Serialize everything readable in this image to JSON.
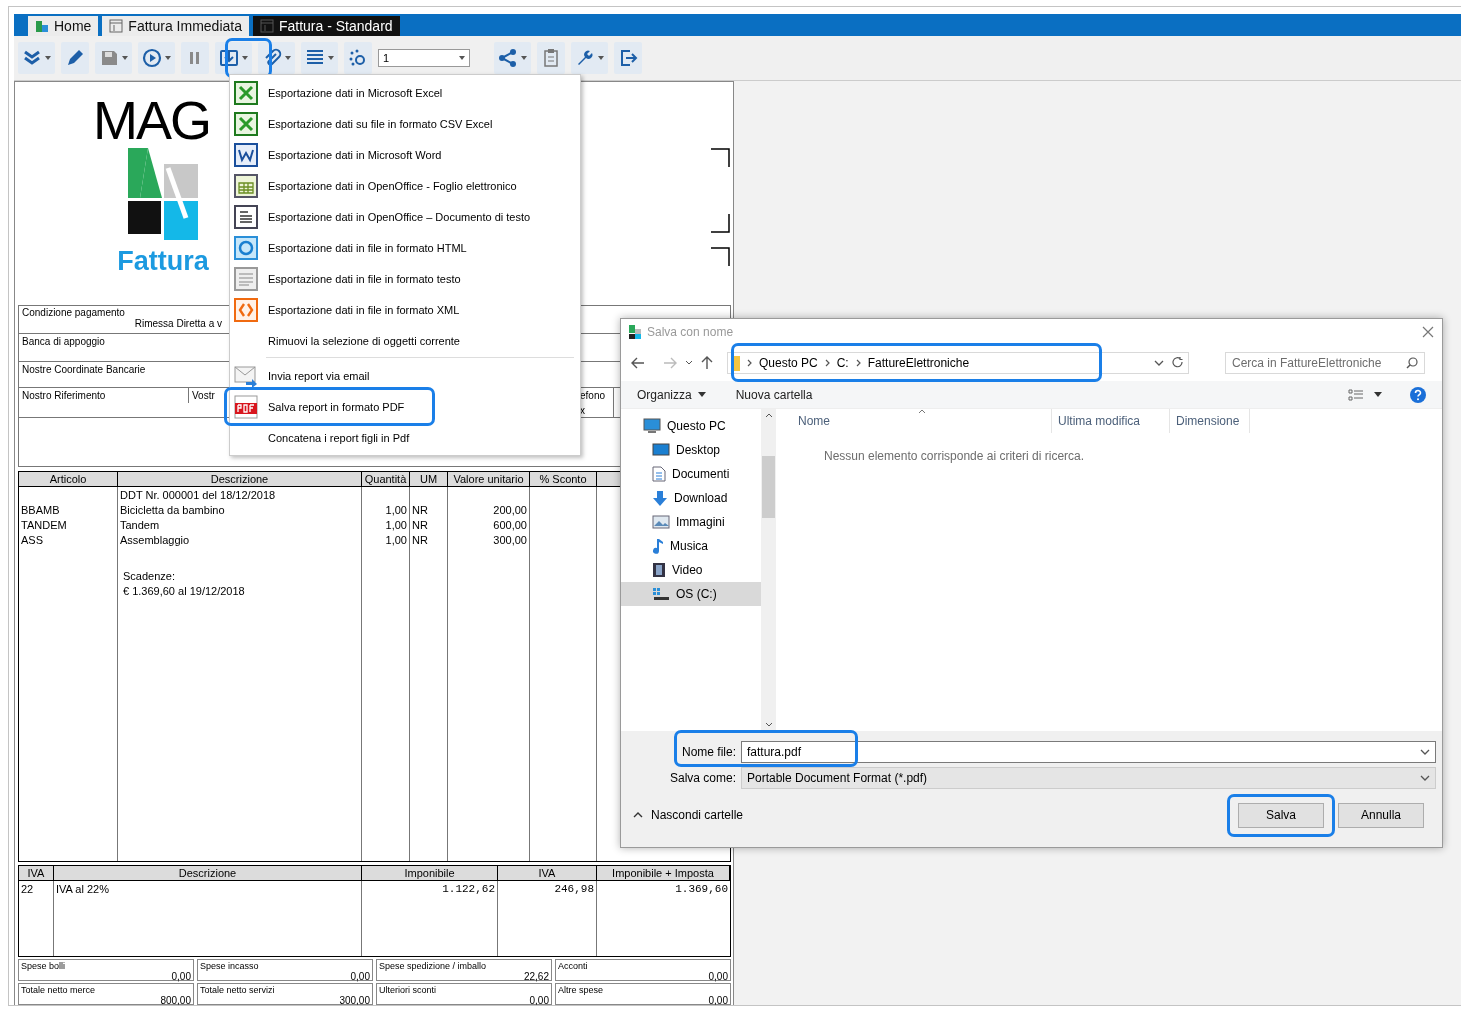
{
  "tabs": [
    {
      "label": "Home",
      "selected": false
    },
    {
      "label": "Fattura Immediata",
      "selected": false
    },
    {
      "label": "Fattura - Standard",
      "selected": true
    }
  ],
  "toolbar": {
    "export_highlighted": true,
    "page_field": {
      "value": "1"
    }
  },
  "report": {
    "logo_text": "MAG",
    "title": "Fattura",
    "info": {
      "payment_label": "Condizione pagamento",
      "payment_value": "Rimessa Diretta a v",
      "bank_label": "Banca di appoggio",
      "coordinates_label": "Nostre Coordinate Bancarie",
      "our_reference_label": "Nostro Riferimento",
      "your_reference_label": "Vostr",
      "phone_label": "efono",
      "fax_label": "x"
    },
    "items_table": {
      "columns": [
        "Articolo",
        "Descrizione",
        "Quantità",
        "UM",
        "Valore unitario",
        "% Sconto"
      ],
      "rows": [
        {
          "description": "DDT Nr. 000001 del 18/12/2018"
        },
        {
          "article": "BBAMB",
          "description": "Bicicletta da bambino",
          "quantity": "1,00",
          "um": "NR",
          "unit_value": "200,00"
        },
        {
          "article": "TANDEM",
          "description": "Tandem",
          "quantity": "1,00",
          "um": "NR",
          "unit_value": "600,00"
        },
        {
          "article": "ASS",
          "description": "Assemblaggio",
          "quantity": "1,00",
          "um": "NR",
          "unit_value": "300,00"
        }
      ],
      "notes": [
        "Scadenze:",
        "€ 1.369,60 al 19/12/2018"
      ]
    },
    "vat_table": {
      "columns": [
        "IVA",
        "Descrizione",
        "Imponibile",
        "IVA",
        "Imponibile + Imposta"
      ],
      "rows": [
        {
          "code": "22",
          "description": "IVA al 22%",
          "taxable": "1.122,62",
          "vat": "246,98",
          "total": "1.369,60"
        }
      ]
    },
    "totals": [
      {
        "label": "Spese bolli",
        "value": "0,00"
      },
      {
        "label": "Spese incasso",
        "value": "0,00"
      },
      {
        "label": "Spese spedizione / imballo",
        "value": "22,62"
      },
      {
        "label": "Acconti",
        "value": "0,00"
      },
      {
        "label": "Totale netto merce",
        "value": "800,00"
      },
      {
        "label": "Totale netto servizi",
        "value": "300,00"
      },
      {
        "label": "Ulteriori sconti",
        "value": "0,00"
      },
      {
        "label": "Altre spese",
        "value": "0,00"
      }
    ]
  },
  "menu": {
    "sections": [
      [
        {
          "label": "Esportazione dati in Microsoft Excel",
          "highlighted": false
        },
        {
          "label": "Esportazione dati su file in formato CSV Excel",
          "highlighted": false
        },
        {
          "label": "Esportazione dati in Microsoft Word",
          "highlighted": false
        },
        {
          "label": "Esportazione dati in OpenOffice - Foglio elettronico",
          "highlighted": false
        },
        {
          "label": "Esportazione dati in OpenOffice – Documento di testo",
          "highlighted": false
        },
        {
          "label": "Esportazione dati in file in formato HTML",
          "highlighted": false
        },
        {
          "label": "Esportazione dati in file in formato testo",
          "highlighted": false
        },
        {
          "label": "Esportazione dati in file in formato XML",
          "highlighted": false
        },
        {
          "label": "Rimuovi la selezione di oggetti corrente",
          "highlighted": false
        }
      ],
      [
        {
          "label": "Invia report via email",
          "highlighted": false
        },
        {
          "label": "Salva report in formato PDF",
          "highlighted": true
        },
        {
          "label": "Concatena i report figli in Pdf",
          "highlighted": false
        }
      ]
    ]
  },
  "dialog": {
    "title": "Salva con nome",
    "address": {
      "highlighted": true,
      "crumbs": [
        "Questo PC",
        "C:",
        "FattureElettroniche"
      ]
    },
    "search": {
      "placeholder": "Cerca in FattureElettroniche"
    },
    "commands": [
      "Organizza",
      "Nuova cartella"
    ],
    "nav": [
      {
        "label": "Questo PC",
        "selected": false,
        "children": [
          {
            "label": "Desktop",
            "selected": false
          },
          {
            "label": "Documenti",
            "selected": false
          },
          {
            "label": "Download",
            "selected": false
          },
          {
            "label": "Immagini",
            "selected": false
          },
          {
            "label": "Musica",
            "selected": false
          },
          {
            "label": "Video",
            "selected": false
          },
          {
            "label": "OS (C:)",
            "selected": true
          }
        ]
      }
    ],
    "columns": [
      "Nome",
      "Ultima modifica",
      "Dimensione"
    ],
    "empty_message": "Nessun elemento corrisponde ai criteri di ricerca.",
    "file_name": {
      "label": "Nome file:",
      "value": "fattura.pdf",
      "highlighted": true
    },
    "save_as": {
      "label": "Salva come:",
      "value": "Portable Document Format (*.pdf)"
    },
    "hide_folders": "Nascondi cartelle",
    "buttons": [
      {
        "label": "Salva",
        "highlighted": true
      },
      {
        "label": "Annulla",
        "highlighted": false
      }
    ]
  }
}
